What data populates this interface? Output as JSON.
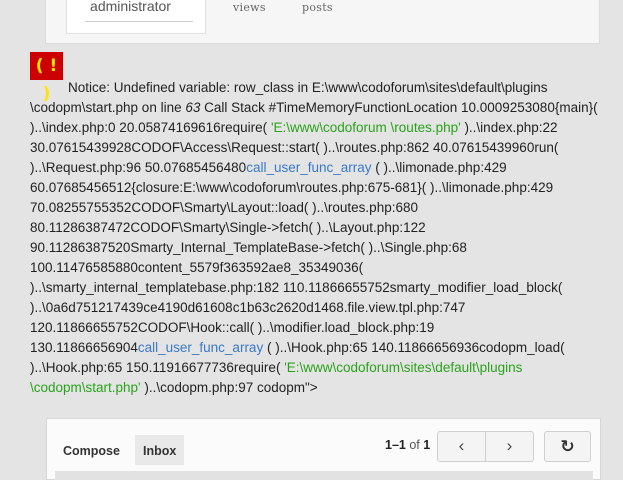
{
  "profile": {
    "username": "administrator",
    "stat_views": "views",
    "stat_posts": "posts"
  },
  "notice": {
    "icon": "( ! )",
    "p1": "Notice: Undefined variable: row_class in E:\\www\\codoforum\\sites\\default\\plugins \\codopm\\start.php on line ",
    "line": "63",
    "p2": " Call Stack #TimeMemoryFunctionLocation 10.0009253080{main}( )..\\index.php:0 20.05874169616require( ",
    "g1": "'E:\\www\\codoforum \\routes.php'",
    "p3": " )..\\index.php:22 30.07615439928CODOF\\Access\\Request::start( )..\\routes.php:862 40.07615439960run( )..\\Request.php:96 50.07685456480",
    "b1": "call_user_func_array",
    "p4": " ( )..\\limonade.php:429 60.07685456512{closure:E:\\www\\codoforum\\routes.php:675-681}( )..\\limonade.php:429 70.08255755352CODOF\\Smarty\\Layout::load( )..\\routes.php:680 80.11286387472CODOF\\Smarty\\Single->fetch( )..\\Layout.php:122 90.11286387520Smarty_Internal_TemplateBase->fetch( )..\\Single.php:68 100.11476585880content_5579f363592ae8_35349036( )..\\smarty_internal_templatebase.php:182 110.11866655752smarty_modifier_load_block( )..\\0a6d751217439ce4190d61608c1b63c2620d1468.file.view.tpl.php:747 120.11866655752CODOF\\Hook::call( )..\\modifier.load_block.php:19 130.11866656904",
    "b2": "call_user_func_array",
    "p5": " ( )..\\Hook.php:65 140.11866656936codopm_load( )..\\Hook.php:65 150.11916677736require( ",
    "g2": "'E:\\www\\codoforum\\sites\\default\\plugins \\codopm\\start.php'",
    "p6": " )..\\codopm.php:97 codopm\">"
  },
  "inbox": {
    "tabs": [
      "Compose",
      "Inbox"
    ],
    "range": "1–1",
    "of": "of",
    "total": "1",
    "prev": "‹",
    "next": "›",
    "refresh": "↻"
  }
}
